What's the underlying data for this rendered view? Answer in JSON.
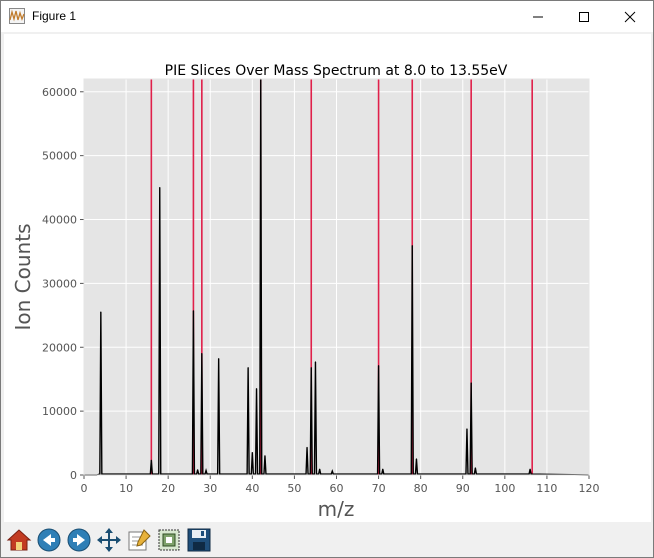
{
  "window": {
    "title": "Figure 1"
  },
  "colors": {
    "slice_line": "#e0204a",
    "spectrum": "#000000",
    "axes_bg": "#e5e5e5",
    "grid": "#ffffff"
  },
  "toolbar": {
    "tools": [
      "home-icon",
      "back-icon",
      "forward-icon",
      "pan-icon",
      "configure-subplots-icon",
      "zoom-icon",
      "save-icon"
    ]
  },
  "chart_data": {
    "type": "line",
    "title": "PIE Slices Over Mass Spectrum at 8.0 to 13.55eV",
    "xlabel": "m/z",
    "ylabel": "Ion Counts",
    "xlim": [
      0,
      120
    ],
    "ylim": [
      0,
      62000
    ],
    "xticks": [
      "0",
      "10",
      "20",
      "30",
      "40",
      "50",
      "60",
      "70",
      "80",
      "90",
      "100",
      "110",
      "120"
    ],
    "yticks": [
      "0",
      "10000",
      "20000",
      "30000",
      "40000",
      "50000",
      "60000"
    ],
    "grid": true,
    "series": [
      {
        "kind": "spectrum",
        "peaks": [
          {
            "x": 4,
            "y": 25500
          },
          {
            "x": 16,
            "y": 2300
          },
          {
            "x": 18,
            "y": 45000
          },
          {
            "x": 26,
            "y": 25700
          },
          {
            "x": 27,
            "y": 800
          },
          {
            "x": 28,
            "y": 19000
          },
          {
            "x": 29,
            "y": 700
          },
          {
            "x": 32,
            "y": 18200
          },
          {
            "x": 39,
            "y": 16800
          },
          {
            "x": 40,
            "y": 3500
          },
          {
            "x": 41,
            "y": 13500
          },
          {
            "x": 42,
            "y": 62000
          },
          {
            "x": 43,
            "y": 3000
          },
          {
            "x": 53,
            "y": 4300
          },
          {
            "x": 54,
            "y": 16800
          },
          {
            "x": 55,
            "y": 17700
          },
          {
            "x": 56,
            "y": 900
          },
          {
            "x": 59,
            "y": 600
          },
          {
            "x": 70,
            "y": 17100
          },
          {
            "x": 71,
            "y": 900
          },
          {
            "x": 78,
            "y": 35900
          },
          {
            "x": 79,
            "y": 2500
          },
          {
            "x": 91,
            "y": 7200
          },
          {
            "x": 92,
            "y": 14400
          },
          {
            "x": 93,
            "y": 1100
          },
          {
            "x": 106,
            "y": 900
          }
        ]
      },
      {
        "kind": "slices",
        "x": [
          16,
          26,
          28,
          42,
          54,
          70,
          78,
          92,
          106.5
        ]
      }
    ]
  }
}
